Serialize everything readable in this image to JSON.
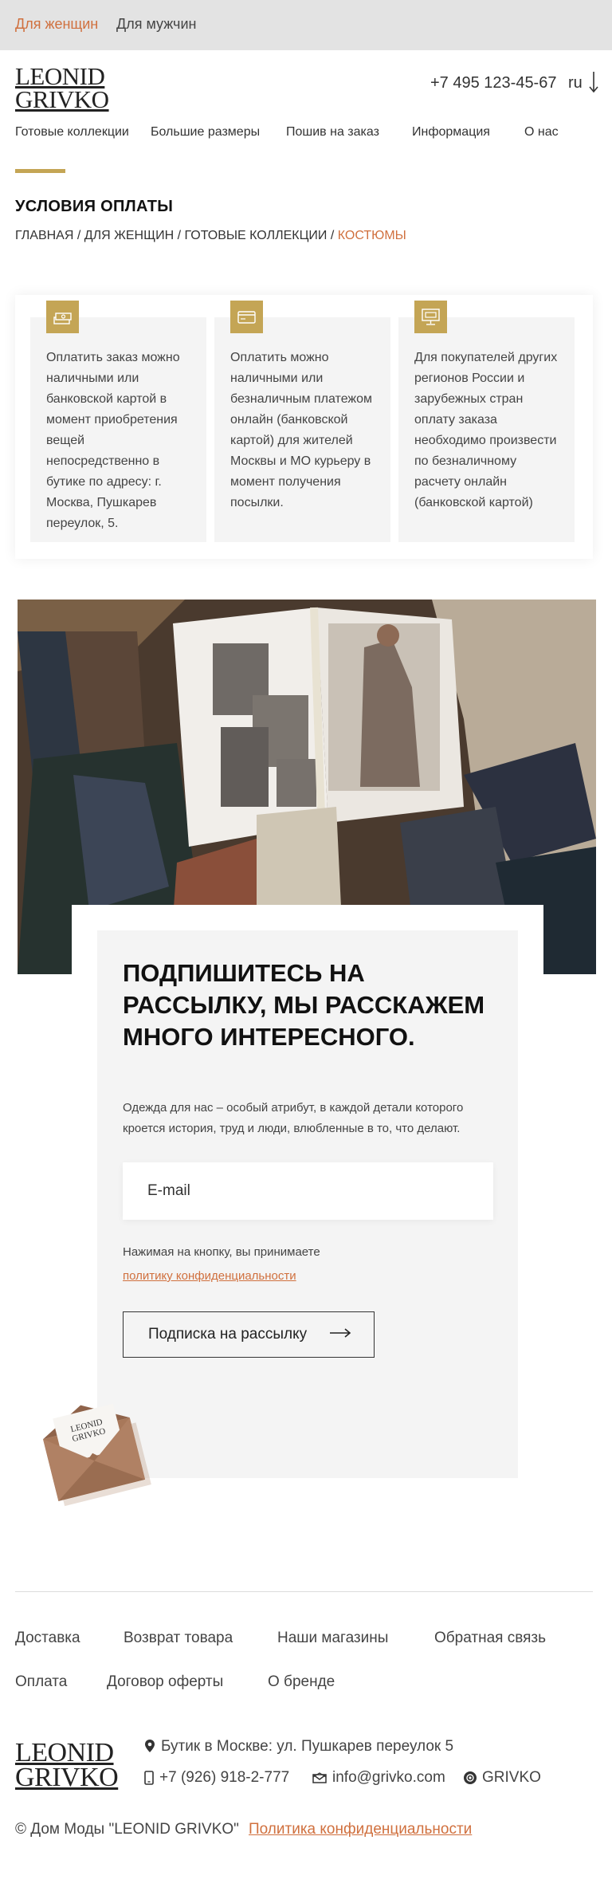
{
  "topbar": {
    "women": "Для женщин",
    "men": "Для мужчин"
  },
  "header": {
    "logo_line1": "LEONID",
    "logo_line2": "GRIVKO",
    "phone": "+7 495 123-45-67",
    "lang": "ru",
    "nav": [
      "Готовые коллекции",
      "Большие размеры",
      "Пошив на заказ",
      "Информация",
      "О нас"
    ]
  },
  "page_title": "УСЛОВИЯ ОПЛАТЫ",
  "breadcrumb": {
    "items": [
      "ГЛАВНАЯ",
      "ДЛЯ ЖЕНЩИН",
      "ГОТОВЫЕ КОЛЛЕКЦИИ"
    ],
    "separator": "/",
    "current": "КОСТЮМЫ"
  },
  "payment_cards": [
    {
      "icon": "cash-icon",
      "text": "Оплатить заказ можно наличными или банковской картой в момент приобретения вещей непосредственно в бутике по адресу: г. Москва, Пушкарев переулок, 5."
    },
    {
      "icon": "card-icon",
      "text": "Оплатить можно наличными или безналичным платежом онлайн (банковской картой) для жителей Москвы и МО курьеру в момент получения посылки."
    },
    {
      "icon": "online-payment-icon",
      "text": "Для покупателей других регионов России и зарубежных стран оплату заказа необходимо произвести по безналичному расчету онлайн (банковской картой)"
    }
  ],
  "subscribe": {
    "title": "ПОДПИШИТЕСЬ НА РАССЫЛКУ, МЫ РАССКАЖЕМ МНОГО ИНТЕРЕСНОГО.",
    "description": "Одежда для нас – особый атрибут, в каждой детали которого кроется история, труд и люди, влюбленные в то, что делают.",
    "email_placeholder": "E-mail",
    "agree_text": "Нажимая на кнопку, вы принимаете",
    "policy_link": "политику конфиденциальности",
    "button_label": "Подписка на рассылку"
  },
  "footer": {
    "links_row1": [
      "Доставка",
      "Возврат товара",
      "Наши магазины",
      "Обратная связь"
    ],
    "links_row2": [
      "Оплата",
      "Договор оферты",
      "О бренде"
    ],
    "logo_line1": "LEONID",
    "logo_line2": "GRIVKO",
    "address": "Бутик в Москве: ул. Пушкарев переулок 5",
    "phone": "+7 (926) 918-2-777",
    "email": "info@grivko.com",
    "brand": "GRIVKO",
    "copyright": "© Дом Моды \"LEONID GRIVKO\"",
    "policy": "Политика конфиденциальности"
  },
  "colors": {
    "accent": "#d0703e",
    "gold": "#c4a555",
    "topbar_bg": "#e3e3e3",
    "card_bg": "#f4f4f4"
  }
}
